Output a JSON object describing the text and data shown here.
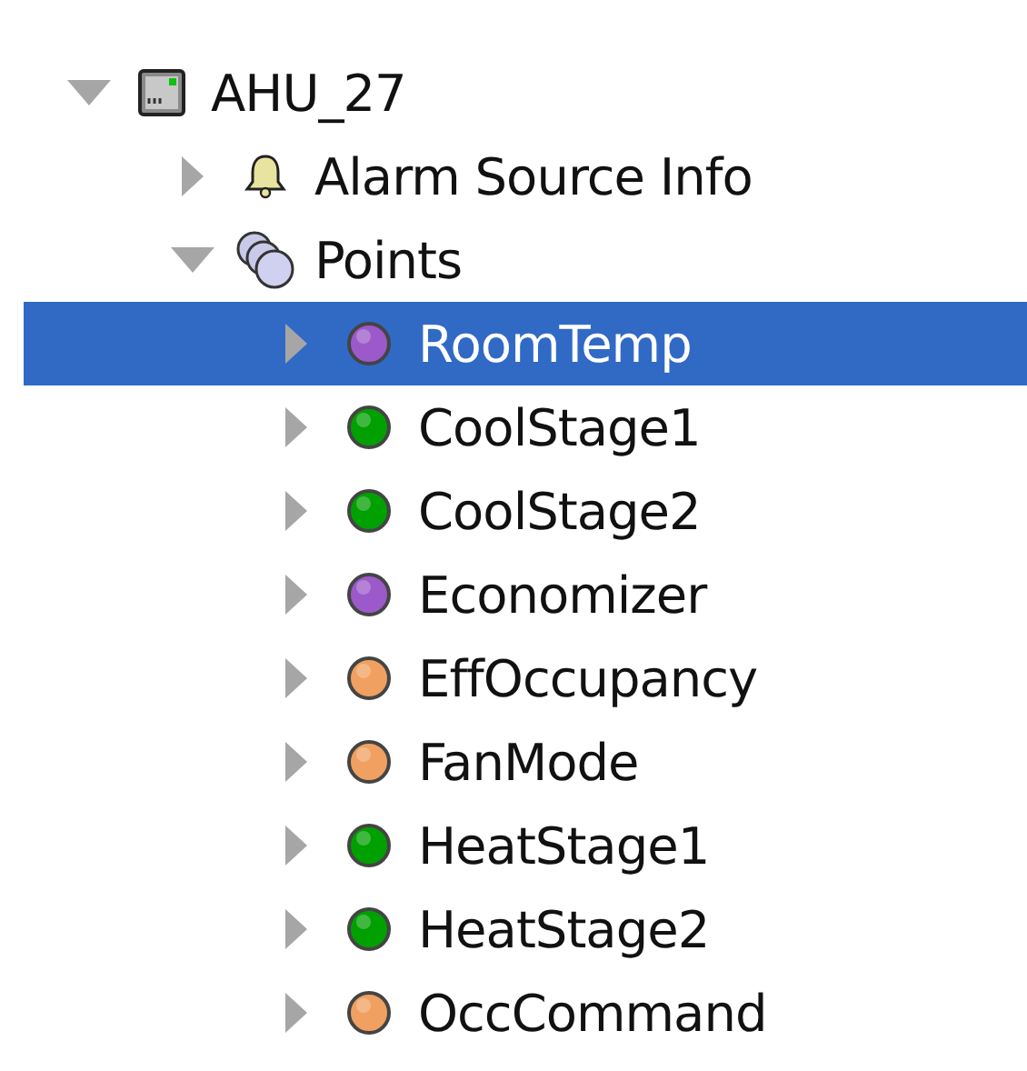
{
  "tree": [
    {
      "label": "AHU_27",
      "kind": "device",
      "expanded": true,
      "selected": false,
      "children": [
        {
          "label": "Alarm Source Info",
          "kind": "alarm",
          "expanded": false,
          "selected": false
        },
        {
          "label": "Points",
          "kind": "folder",
          "expanded": true,
          "selected": false,
          "children": [
            {
              "label": "RoomTemp",
              "kind": "point",
              "color": "#9b59c9",
              "expanded": false,
              "selected": true
            },
            {
              "label": "CoolStage1",
              "kind": "point",
              "color": "#00a000",
              "expanded": false,
              "selected": false
            },
            {
              "label": "CoolStage2",
              "kind": "point",
              "color": "#00a000",
              "expanded": false,
              "selected": false
            },
            {
              "label": "Economizer",
              "kind": "point",
              "color": "#9b59c9",
              "expanded": false,
              "selected": false
            },
            {
              "label": "EffOccupancy",
              "kind": "point",
              "color": "#f0a060",
              "expanded": false,
              "selected": false
            },
            {
              "label": "FanMode",
              "kind": "point",
              "color": "#f0a060",
              "expanded": false,
              "selected": false
            },
            {
              "label": "HeatStage1",
              "kind": "point",
              "color": "#00a000",
              "expanded": false,
              "selected": false
            },
            {
              "label": "HeatStage2",
              "kind": "point",
              "color": "#00a000",
              "expanded": false,
              "selected": false
            },
            {
              "label": "OccCommand",
              "kind": "point",
              "color": "#f0a060",
              "expanded": false,
              "selected": false
            }
          ]
        }
      ]
    }
  ]
}
